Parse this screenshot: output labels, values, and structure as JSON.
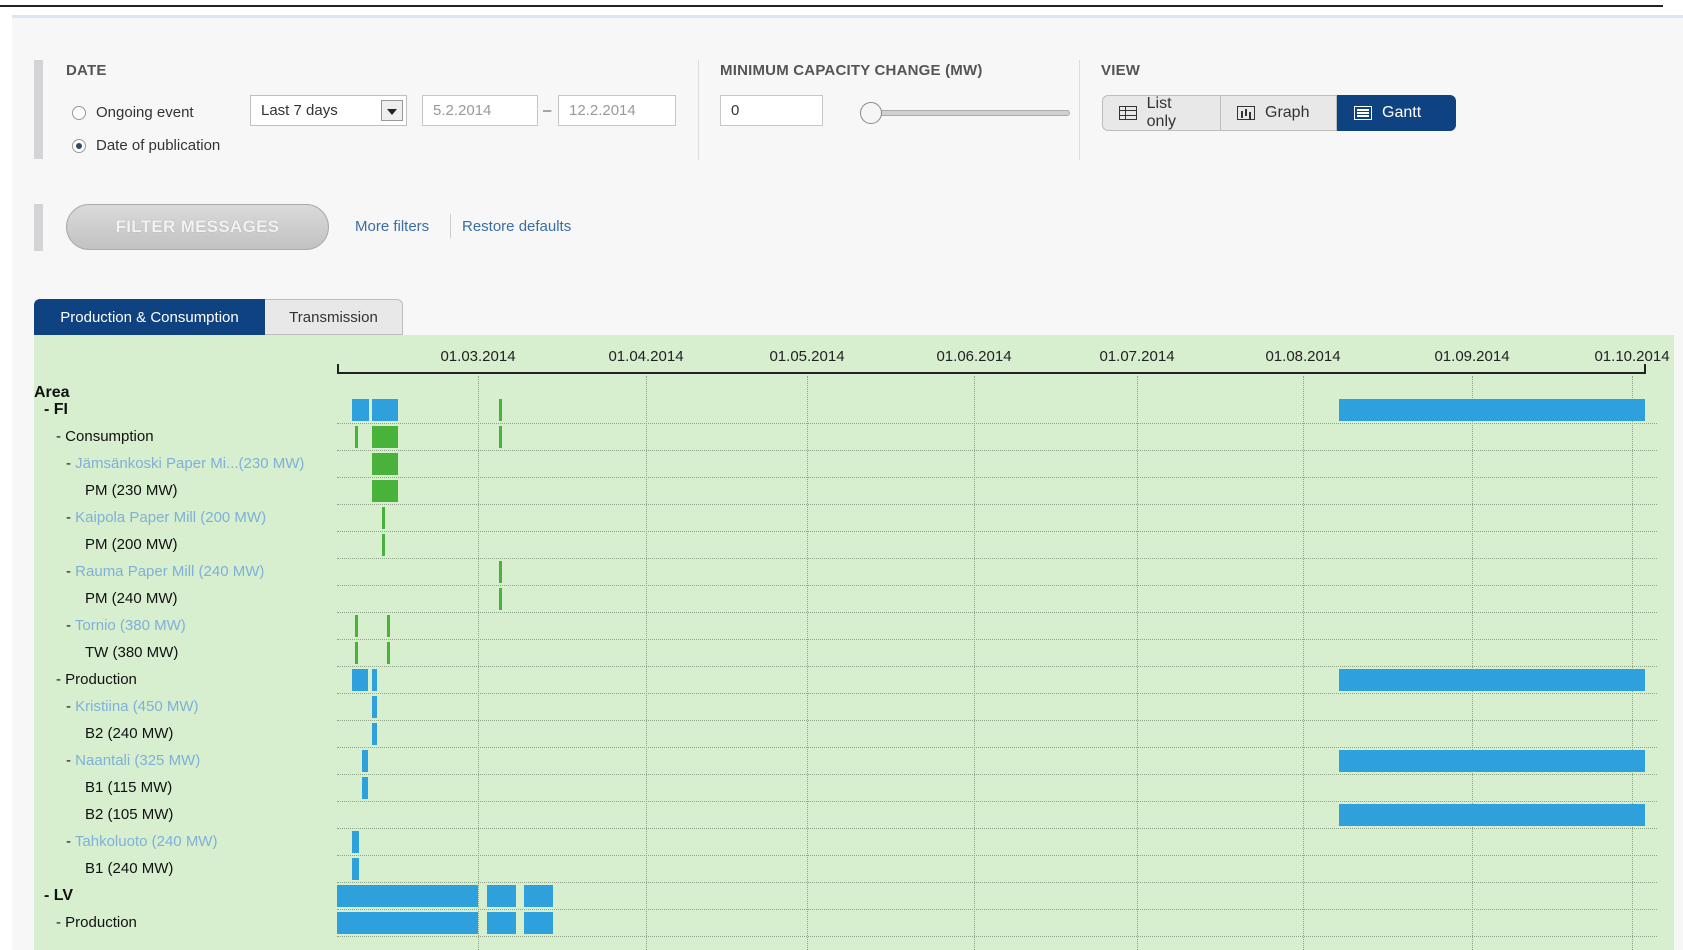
{
  "filters": {
    "date": {
      "heading": "DATE",
      "radio_ongoing": "Ongoing event",
      "radio_publication": "Date of publication",
      "selected": "Date of publication",
      "period_select": "Last 7 days",
      "date_from": "5.2.2014",
      "date_separator": "–",
      "date_to": "12.2.2014"
    },
    "capacity": {
      "heading": "MINIMUM CAPACITY CHANGE (MW)",
      "value": "0",
      "slider_level": 0
    },
    "view": {
      "heading": "VIEW",
      "options": [
        "List only",
        "Graph",
        "Gantt"
      ],
      "active": "Gantt"
    },
    "filter_button": "FILTER MESSAGES",
    "more_filters": "More filters",
    "restore_defaults": "Restore defaults"
  },
  "tabs": [
    {
      "label": "Production & Consumption",
      "active": true
    },
    {
      "label": "Transmission",
      "active": false
    }
  ],
  "gantt": {
    "header_label": "Area",
    "dates": [
      "01.03.2014",
      "01.04.2014",
      "01.05.2014",
      "01.06.2014",
      "01.07.2014",
      "01.08.2014",
      "01.09.2014",
      "01.10.2014"
    ],
    "rows": [
      {
        "prefix": "-",
        "label": "FI",
        "level": 0
      },
      {
        "prefix": "-",
        "label": "Consumption",
        "level": 1
      },
      {
        "prefix": "-",
        "label": "Jämsänkoski Paper Mi...(230 MW)",
        "level": 2
      },
      {
        "prefix": "",
        "label": "PM (230 MW)",
        "level": 3
      },
      {
        "prefix": "-",
        "label": "Kaipola Paper Mill (200 MW)",
        "level": 2
      },
      {
        "prefix": "",
        "label": "PM (200 MW)",
        "level": 3
      },
      {
        "prefix": "-",
        "label": "Rauma Paper Mill (240 MW)",
        "level": 2
      },
      {
        "prefix": "",
        "label": "PM (240 MW)",
        "level": 3
      },
      {
        "prefix": "-",
        "label": "Tornio (380 MW)",
        "level": 2
      },
      {
        "prefix": "",
        "label": "TW (380 MW)",
        "level": 3
      },
      {
        "prefix": "-",
        "label": "Production",
        "level": 1
      },
      {
        "prefix": "-",
        "label": "Kristiina (450 MW)",
        "level": 2
      },
      {
        "prefix": "",
        "label": "B2 (240 MW)",
        "level": 3
      },
      {
        "prefix": "-",
        "label": "Naantali (325 MW)",
        "level": 2
      },
      {
        "prefix": "",
        "label": "B1 (115 MW)",
        "level": 3
      },
      {
        "prefix": "",
        "label": "B2 (105 MW)",
        "level": 3
      },
      {
        "prefix": "-",
        "label": "Tahkoluoto (240 MW)",
        "level": 2
      },
      {
        "prefix": "",
        "label": "B1 (240 MW)",
        "level": 3
      },
      {
        "prefix": "-",
        "label": "LV",
        "level": 0
      },
      {
        "prefix": "-",
        "label": "Production",
        "level": 1
      }
    ],
    "colors": {
      "production": "#2ea0dc",
      "consumption": "#48b23a",
      "active_tab": "#0f4280",
      "plant_link": "#7fb0d8"
    }
  }
}
